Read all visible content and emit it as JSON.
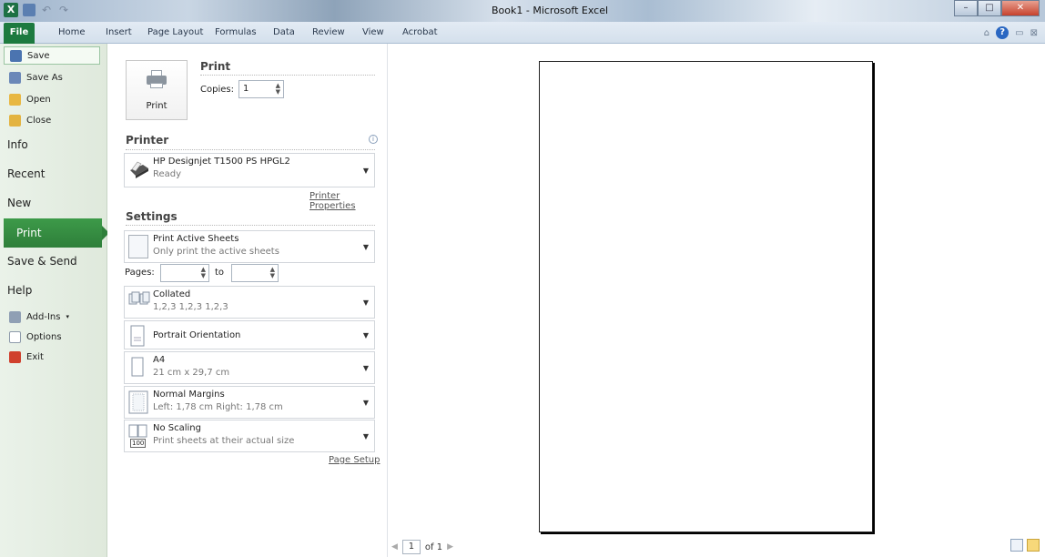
{
  "window": {
    "title": "Book1 - Microsoft Excel"
  },
  "ribbon": {
    "file_tab": "File",
    "tabs": [
      "Home",
      "Insert",
      "Page Layout",
      "Formulas",
      "Data",
      "Review",
      "View",
      "Acrobat"
    ]
  },
  "backstage": {
    "small_items": [
      {
        "label": "Save",
        "icon": "save-icon"
      },
      {
        "label": "Save As",
        "icon": "save-as-icon"
      },
      {
        "label": "Open",
        "icon": "open-folder-icon"
      },
      {
        "label": "Close",
        "icon": "close-folder-icon"
      }
    ],
    "info": "Info",
    "recent": "Recent",
    "new": "New",
    "print": "Print",
    "save_send": "Save & Send",
    "help": "Help",
    "addins": "Add-Ins",
    "options": "Options",
    "exit": "Exit"
  },
  "print": {
    "title": "Print",
    "button_label": "Print",
    "copies_label": "Copies:",
    "copies_value": "1",
    "printer_title": "Printer",
    "printer_name": "HP Designjet T1500 PS HPGL2",
    "printer_status": "Ready",
    "printer_properties": "Printer Properties",
    "settings_title": "Settings",
    "what": {
      "t1": "Print Active Sheets",
      "t2": "Only print the active sheets"
    },
    "pages_label": "Pages:",
    "to_label": "to",
    "collate": {
      "t1": "Collated",
      "t2": "1,2,3   1,2,3   1,2,3"
    },
    "orientation": "Portrait Orientation",
    "paper": {
      "t1": "A4",
      "t2": "21 cm x 29,7 cm"
    },
    "margins": {
      "t1": "Normal Margins",
      "t2": "Left: 1,78 cm   Right: 1,78 cm"
    },
    "scaling": {
      "t1": "No Scaling",
      "t2": "Print sheets at their actual size",
      "badge": "100"
    },
    "page_setup": "Page Setup"
  },
  "preview": {
    "page_number": "1",
    "page_of": "of 1"
  }
}
